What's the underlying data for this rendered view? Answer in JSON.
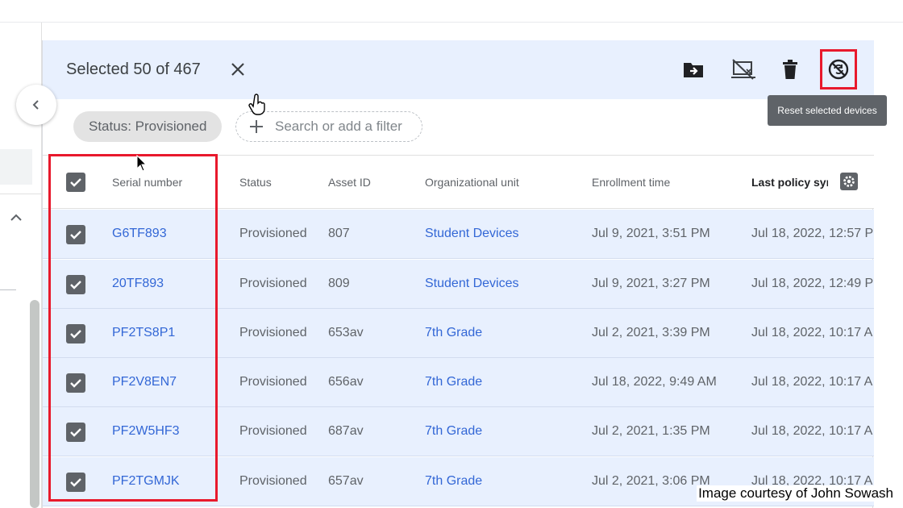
{
  "selection": {
    "label": "Selected 50 of 467",
    "tooltip": "Reset selected devices",
    "toolbar_icons": [
      "move-to-ou-icon",
      "deprovision-icon",
      "delete-icon",
      "reset-icon"
    ]
  },
  "filters": {
    "chip": "Status: Provisioned",
    "search_placeholder": "Search or add a filter"
  },
  "table": {
    "headers": {
      "serial": "Serial number",
      "status": "Status",
      "asset": "Asset ID",
      "ou": "Organizational unit",
      "enroll": "Enrollment time",
      "policy": "Last policy syı"
    },
    "rows": [
      {
        "serial": "G6TF893",
        "status": "Provisioned",
        "asset": "807",
        "ou": "Student Devices",
        "enroll": "Jul 9, 2021, 3:51 PM",
        "policy": "Jul 18, 2022, 12:57 P",
        "checked": true
      },
      {
        "serial": "20TF893",
        "status": "Provisioned",
        "asset": "809",
        "ou": "Student Devices",
        "enroll": "Jul 9, 2021, 3:27 PM",
        "policy": "Jul 18, 2022, 12:49 P",
        "checked": true
      },
      {
        "serial": "PF2TS8P1",
        "status": "Provisioned",
        "asset": "653av",
        "ou": "7th Grade",
        "enroll": "Jul 2, 2021, 3:39 PM",
        "policy": "Jul 18, 2022, 10:17 A",
        "checked": true
      },
      {
        "serial": "PF2V8EN7",
        "status": "Provisioned",
        "asset": "656av",
        "ou": "7th Grade",
        "enroll": "Jul 18, 2022, 9:49 AM",
        "policy": "Jul 18, 2022, 10:17 A",
        "checked": true
      },
      {
        "serial": "PF2W5HF3",
        "status": "Provisioned",
        "asset": "687av",
        "ou": "7th Grade",
        "enroll": "Jul 2, 2021, 1:35 PM",
        "policy": "Jul 18, 2022, 10:17 A",
        "checked": true
      },
      {
        "serial": "PF2TGMJK",
        "status": "Provisioned",
        "asset": "657av",
        "ou": "7th Grade",
        "enroll": "Jul 2, 2021, 3:06 PM",
        "policy": "Jul 18, 2022, 10:17 A",
        "checked": true
      }
    ]
  },
  "caption": "Image courtesy of John Sowash",
  "colors": {
    "selection_bg": "#e8f0fe",
    "link": "#3367d6",
    "highlight": "#e8192c",
    "checkbox": "#5f6368"
  }
}
